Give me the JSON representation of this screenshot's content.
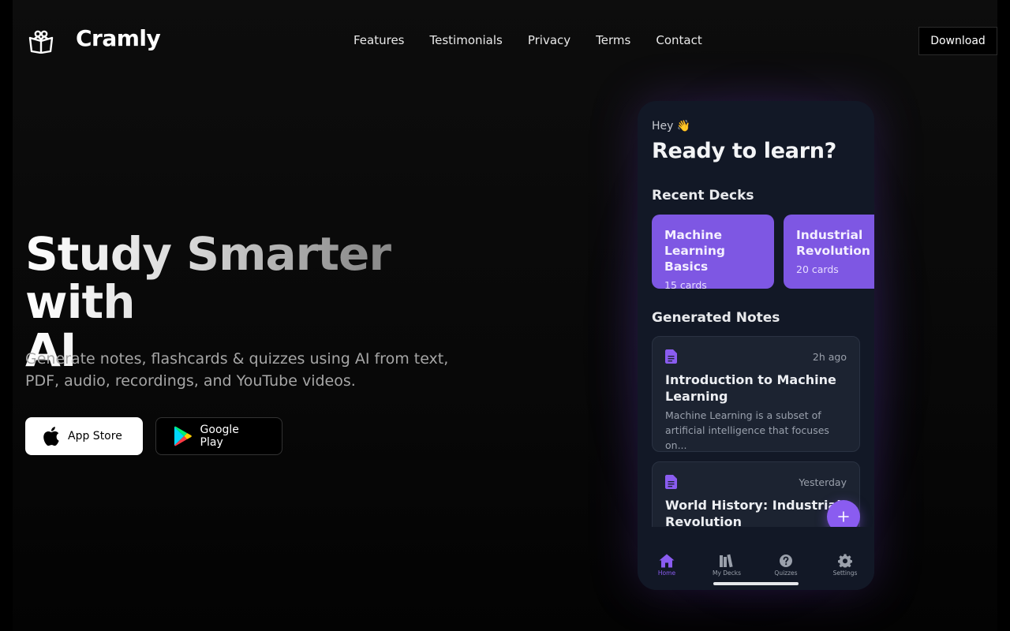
{
  "header": {
    "brand": "Cramly",
    "nav": [
      "Features",
      "Testimonials",
      "Privacy",
      "Terms",
      "Contact"
    ],
    "download_label": "Download"
  },
  "hero": {
    "title_line1": "Study Smarter with",
    "title_line2": "AI",
    "subtitle_line1": "Generate notes, flashcards & quizzes using AI from text,",
    "subtitle_line2": "PDF, audio, recordings, and YouTube videos.",
    "app_store_label": "App Store",
    "google_play_label": "Google Play"
  },
  "phone": {
    "greeting": "Hey 👋",
    "headline": "Ready to learn?",
    "recent_decks_title": "Recent Decks",
    "decks": [
      {
        "name_line1": "Machine",
        "name_line2": "Learning Basics",
        "count": "15 cards"
      },
      {
        "name_line1": "Industrial",
        "name_line2": "Revolution",
        "count": "20 cards"
      }
    ],
    "generated_notes_title": "Generated Notes",
    "notes": [
      {
        "time": "2h ago",
        "title": "Introduction to Machine Learning",
        "text_line1": "Machine Learning is a subset of",
        "text_line2": "artificial intelligence that focuses on..."
      },
      {
        "time": "Yesterday",
        "title": "World History: Industrial Revolution"
      }
    ],
    "tabs": [
      "Home",
      "My Decks",
      "Quizzes",
      "Settings"
    ]
  },
  "colors": {
    "accent": "#8a5cf0",
    "deck": "#7e57e3",
    "phone_bg": "#121826",
    "note_bg": "#1c2331"
  }
}
